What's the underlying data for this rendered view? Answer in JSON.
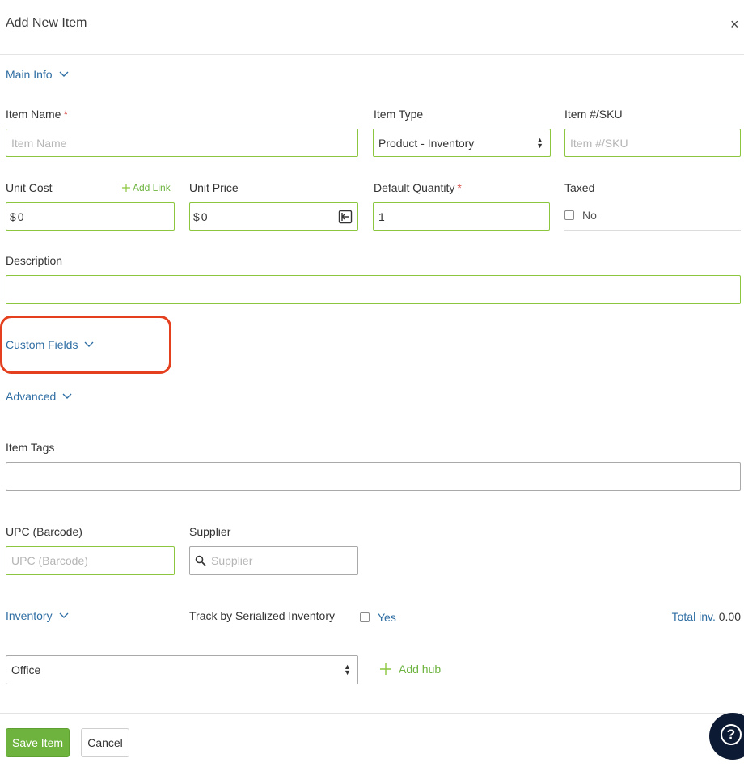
{
  "dialog": {
    "title": "Add New Item",
    "close_glyph": "×"
  },
  "sections": {
    "main_info": "Main Info",
    "custom_fields": "Custom Fields",
    "advanced": "Advanced",
    "inventory": "Inventory"
  },
  "fields": {
    "item_name": {
      "label": "Item Name",
      "required": "*",
      "placeholder": "Item Name",
      "value": ""
    },
    "item_type": {
      "label": "Item Type",
      "value": "Product - Inventory"
    },
    "sku": {
      "label": "Item #/SKU",
      "placeholder": "Item #/SKU"
    },
    "unit_cost": {
      "label": "Unit Cost",
      "prefix": "$",
      "value": "0",
      "add_link": "Add Link"
    },
    "unit_price": {
      "label": "Unit Price",
      "prefix": "$",
      "value": "0"
    },
    "default_quantity": {
      "label": "Default Quantity",
      "required": "*",
      "value": "1"
    },
    "taxed": {
      "label": "Taxed",
      "option": "No"
    },
    "description": {
      "label": "Description",
      "value": ""
    },
    "item_tags": {
      "label": "Item Tags",
      "value": ""
    },
    "upc": {
      "label": "UPC (Barcode)",
      "placeholder": "UPC (Barcode)"
    },
    "supplier": {
      "label": "Supplier",
      "placeholder": "Supplier"
    }
  },
  "inventory": {
    "track_label": "Track by Serialized Inventory",
    "track_option": "Yes",
    "total_label": "Total inv.",
    "total_value": "0.00",
    "hub_value": "Office",
    "add_hub": "Add hub"
  },
  "footer": {
    "save_label": "Save Item",
    "cancel_label": "Cancel",
    "help_glyph": "?"
  },
  "colors": {
    "accent_link": "#2f6ea3",
    "valid_border": "#8cc63f",
    "save_button": "#6fb33f",
    "highlight": "#e4401f",
    "help_bg": "#0d1a33"
  }
}
